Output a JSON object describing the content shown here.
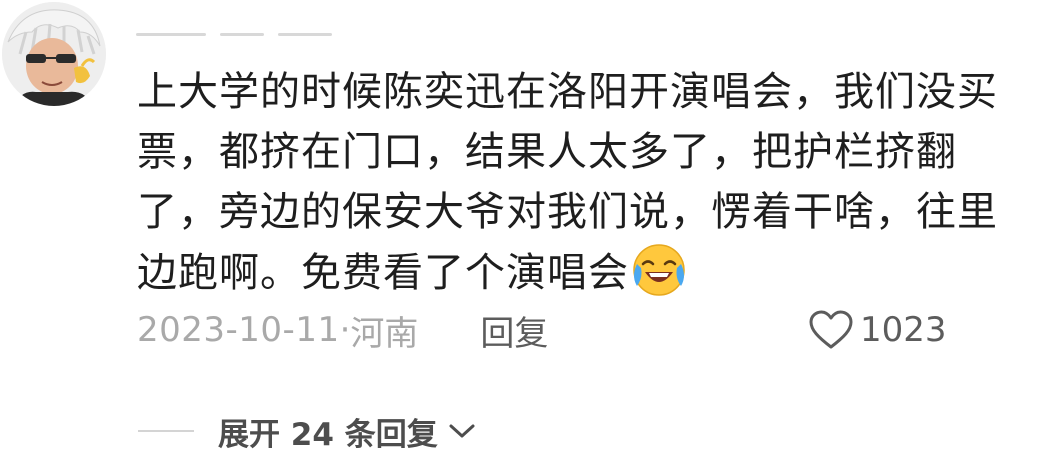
{
  "comment": {
    "text": "上大学的时候陈奕迅在洛阳开演唱会，我们没买票，都挤在门口，结果人太多了，把护栏挤翻了，旁边的保安大爷对我们说，愣着干啥，往里边跑啊。免费看了个演唱会",
    "emoji": "laughing-tears-emoji",
    "date": "2023-10-11",
    "separator": "·",
    "location": "河南",
    "reply_label": "回复",
    "like_count": "1023"
  },
  "expand_replies": {
    "label": "展开 24 条回复"
  },
  "colors": {
    "text": "#1e1e1e",
    "meta": "#a9a9a9",
    "action": "#5c5c5c",
    "divider": "#d4d4d4",
    "emoji_face": "#ffc83d"
  }
}
